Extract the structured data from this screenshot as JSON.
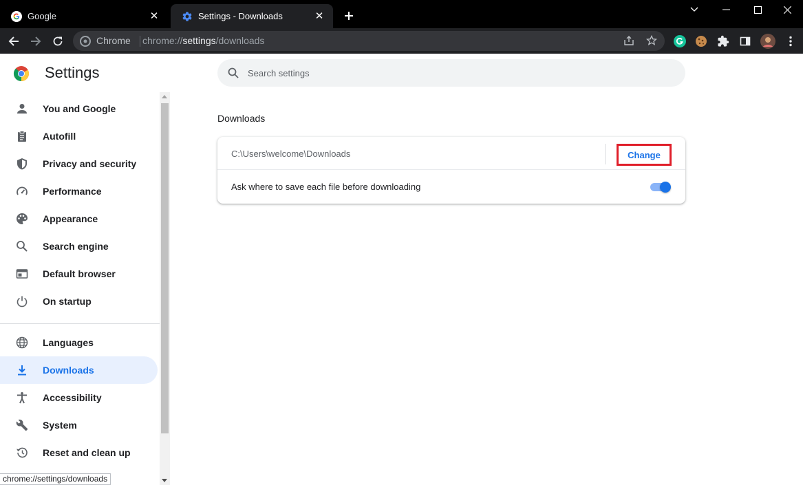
{
  "tabs": [
    {
      "title": "Google",
      "favicon": "google-g-icon",
      "active": false
    },
    {
      "title": "Settings - Downloads",
      "favicon": "settings-gear-icon",
      "active": true
    }
  ],
  "toolbar": {
    "omnibox_chip": "Chrome",
    "url_scheme": "chrome://",
    "url_host": "settings",
    "url_path": "/downloads"
  },
  "page": {
    "title": "Settings",
    "search_placeholder": "Search settings"
  },
  "sidebar": {
    "items": [
      {
        "label": "You and Google",
        "icon": "person-icon"
      },
      {
        "label": "Autofill",
        "icon": "clipboard-icon"
      },
      {
        "label": "Privacy and security",
        "icon": "shield-icon"
      },
      {
        "label": "Performance",
        "icon": "speedometer-icon"
      },
      {
        "label": "Appearance",
        "icon": "palette-icon"
      },
      {
        "label": "Search engine",
        "icon": "search-icon"
      },
      {
        "label": "Default browser",
        "icon": "browser-window-icon"
      },
      {
        "label": "On startup",
        "icon": "power-icon"
      },
      {
        "label": "Languages",
        "icon": "globe-icon"
      },
      {
        "label": "Downloads",
        "icon": "download-icon",
        "active": true
      },
      {
        "label": "Accessibility",
        "icon": "accessibility-icon"
      },
      {
        "label": "System",
        "icon": "wrench-icon"
      },
      {
        "label": "Reset and clean up",
        "icon": "restore-icon"
      }
    ]
  },
  "downloads": {
    "section_title": "Downloads",
    "location_path": "C:\\Users\\welcome\\Downloads",
    "change_label": "Change",
    "ask_label": "Ask where to save each file before downloading",
    "ask_enabled": true
  },
  "status_bar": {
    "url": "chrome://settings/downloads"
  },
  "colors": {
    "accent": "#1a73e8",
    "highlight_box": "#e01f2a",
    "active_nav_bg": "#e8f0fe"
  }
}
